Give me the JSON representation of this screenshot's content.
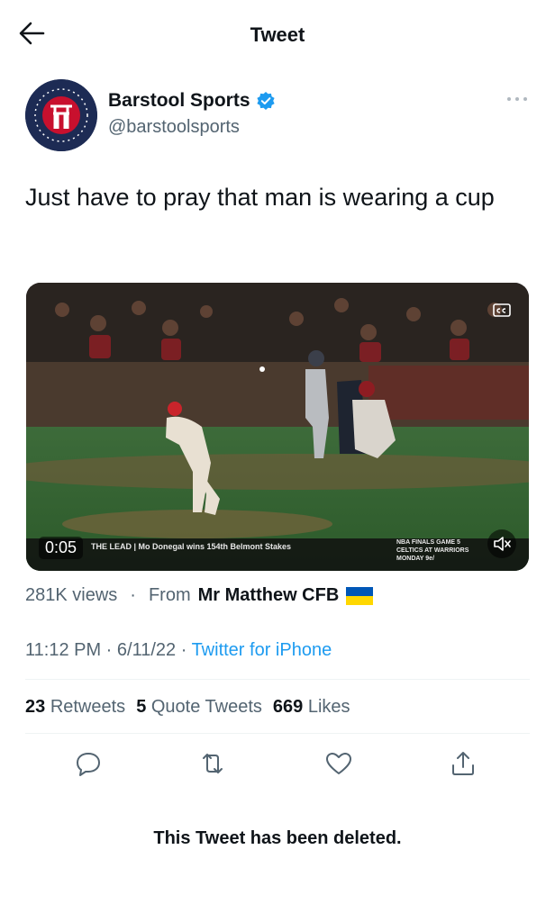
{
  "header": {
    "title": "Tweet",
    "back_icon": "arrow-left-icon"
  },
  "author": {
    "display_name": "Barstool Sports",
    "handle": "@barstoolsports",
    "verified_icon": "verified-badge-icon",
    "avatar_icon": "barstool-logo"
  },
  "tweet": {
    "text": "Just have to pray that man is wearing a cup"
  },
  "media": {
    "duration": "0:05",
    "ticker_left": "THE LEAD | Mo Donegal wins 154th Belmont Stakes",
    "ticker_right_line1": "NBA FINALS GAME 5",
    "ticker_right_line2": "CELTICS AT WARRIORS",
    "ticker_right_line3": "MONDAY 9e/"
  },
  "views": {
    "count": "281K views",
    "separator": "·",
    "from_label": "From",
    "from_name": "Mr Matthew CFB",
    "flag_colors": [
      "#0057b7",
      "#ffd700"
    ]
  },
  "meta": {
    "time": "11:12 PM · 6/11/22 · ",
    "source": "Twitter for iPhone"
  },
  "stats": {
    "retweets_count": "23",
    "retweets_label": "Retweets",
    "quotes_count": "5",
    "quotes_label": "Quote Tweets",
    "likes_count": "669",
    "likes_label": "Likes"
  },
  "actions": [
    "reply-icon",
    "retweet-icon",
    "like-icon",
    "share-icon"
  ],
  "deleted_notice": "This Tweet has been deleted.",
  "colors": {
    "link": "#1d9bf0",
    "muted": "#536471",
    "text": "#0f1419"
  }
}
